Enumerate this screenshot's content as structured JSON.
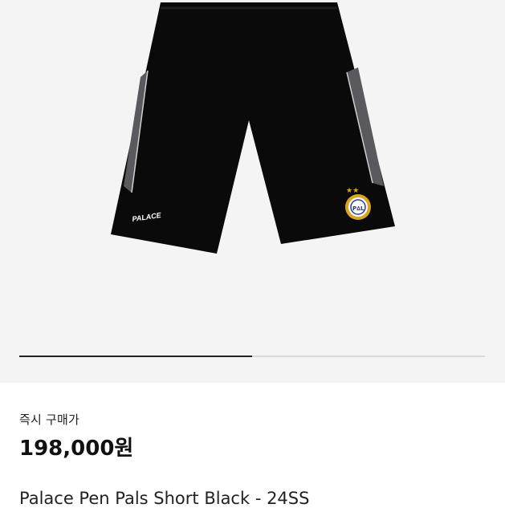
{
  "product": {
    "image_logo_text": "PALACE",
    "image_alt": "product-photo",
    "title": "Palace Pen Pals Short Black - 24SS"
  },
  "carousel": {
    "progress_fraction": 0.5
  },
  "purchase": {
    "price_label": "즉시 구매가",
    "price": "198,000원"
  },
  "colors": {
    "hero_background": "#f4f4f4",
    "shorts_body": "#0a0a0a",
    "side_panel": "#555559",
    "crest_gold": "#d9a520"
  }
}
